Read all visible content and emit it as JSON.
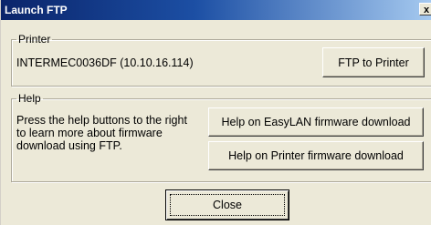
{
  "window": {
    "title": "Launch FTP",
    "close_glyph": "x"
  },
  "printer_group": {
    "legend": "Printer",
    "printer_name": "INTERMEC0036DF (10.10.16.114)",
    "ftp_button_label": "FTP to Printer"
  },
  "help_group": {
    "legend": "Help",
    "description": "Press the help buttons to the right to learn more about firmware download using FTP.",
    "easylan_button_label": "Help on EasyLAN firmware download",
    "printer_fw_button_label": "Help on Printer firmware download"
  },
  "footer": {
    "close_button_label": "Close"
  }
}
